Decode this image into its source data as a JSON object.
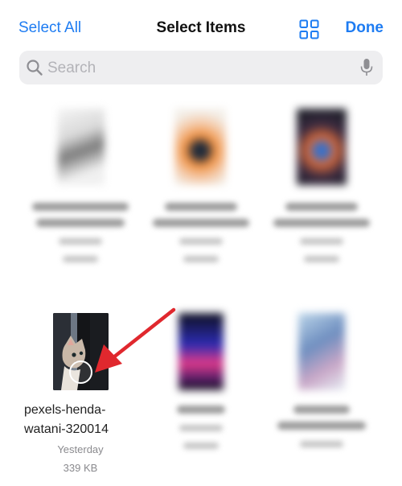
{
  "nav": {
    "select_all": "Select All",
    "title": "Select Items",
    "done": "Done",
    "grid_icon": "grid-view-icon"
  },
  "search": {
    "placeholder": "Search",
    "search_icon": "magnifying-glass-icon",
    "mic_icon": "microphone-icon"
  },
  "files": [
    {
      "name_line1": "pexels-henda-",
      "name_line2": "watani-320014",
      "date": "Yesterday",
      "size": "339 KB",
      "selected": true
    }
  ],
  "colors": {
    "accent": "#1e7cf2",
    "annotation_arrow": "#e0282e",
    "search_bg": "#eeeef0"
  }
}
